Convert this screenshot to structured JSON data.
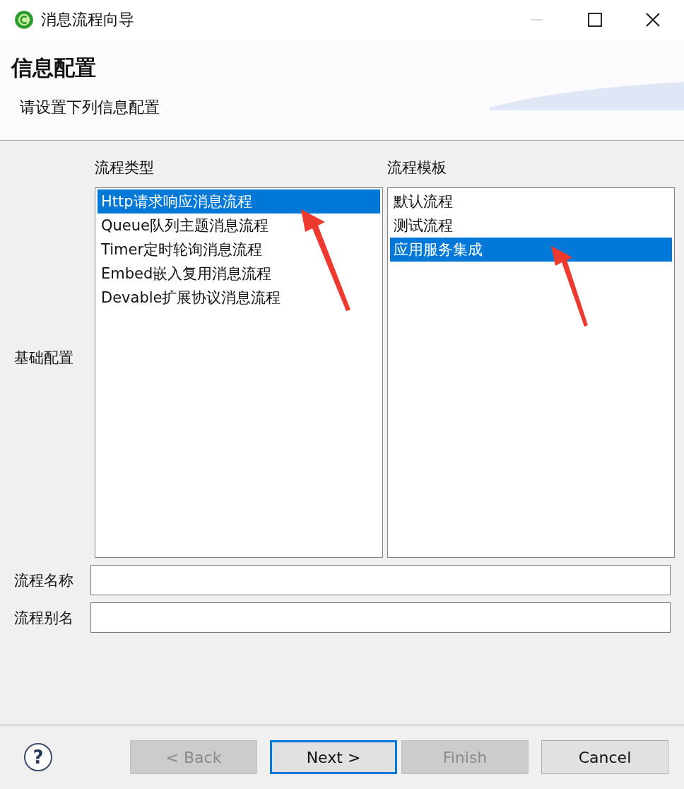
{
  "window": {
    "title": "消息流程向导",
    "minimize_disabled": true
  },
  "header": {
    "title": "信息配置",
    "subtitle": "请设置下列信息配置"
  },
  "section_label": "基础配置",
  "lists": [
    {
      "label": "流程类型",
      "items": [
        {
          "text": "Http请求响应消息流程",
          "selected": true
        },
        {
          "text": "Queue队列主题消息流程",
          "selected": false
        },
        {
          "text": "Timer定时轮询消息流程",
          "selected": false
        },
        {
          "text": "Embed嵌入复用消息流程",
          "selected": false
        },
        {
          "text": "Devable扩展协议消息流程",
          "selected": false
        }
      ]
    },
    {
      "label": "流程模板",
      "items": [
        {
          "text": "默认流程",
          "selected": false
        },
        {
          "text": "测试流程",
          "selected": false
        },
        {
          "text": "应用服务集成",
          "selected": true
        }
      ]
    }
  ],
  "fields": [
    {
      "label": "流程名称"
    },
    {
      "label": "流程别名"
    }
  ],
  "help": "?",
  "buttons": [
    {
      "label": "< Back",
      "disabled": true,
      "default": false
    },
    {
      "label": "Next >",
      "disabled": false,
      "default": true
    },
    {
      "label": "Finish",
      "disabled": true,
      "default": false
    },
    {
      "label": "Cancel",
      "disabled": false,
      "default": false
    }
  ]
}
